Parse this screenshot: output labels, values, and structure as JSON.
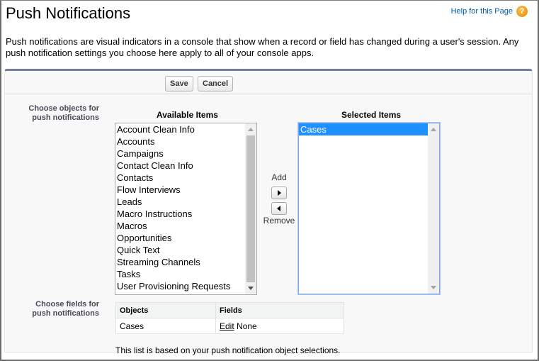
{
  "page": {
    "title": "Push Notifications",
    "help_link": "Help for this Page",
    "help_icon": "question-circle-icon",
    "description": "Push notifications are visual indicators in a console that show when a record or field has changed during a user's session. Any push notification settings you choose here apply to all of your console apps."
  },
  "toolbar": {
    "save_label": "Save",
    "cancel_label": "Cancel"
  },
  "objects_section": {
    "label_line1": "Choose objects for",
    "label_line2": "push notifications",
    "available_heading": "Available Items",
    "selected_heading": "Selected Items",
    "available_items": [
      "Account Clean Info",
      "Accounts",
      "Campaigns",
      "Contact Clean Info",
      "Contacts",
      "Flow Interviews",
      "Leads",
      "Macro Instructions",
      "Macros",
      "Opportunities",
      "Quick Text",
      "Streaming Channels",
      "Tasks",
      "User Provisioning Requests"
    ],
    "selected_items": [
      "Cases"
    ],
    "selected_highlighted": "Cases",
    "add_label": "Add",
    "remove_label": "Remove",
    "add_icon": "arrow-right-icon",
    "remove_icon": "arrow-left-icon"
  },
  "fields_section": {
    "label_line1": "Choose fields for",
    "label_line2": "push notifications",
    "columns": [
      "Objects",
      "Fields"
    ],
    "rows": [
      {
        "object": "Cases",
        "edit_label": "Edit",
        "fields": "None"
      }
    ],
    "note": "This list is based on your push notification object selections."
  },
  "colors": {
    "panel_top_border": "#747e96",
    "selection": "#1e90ff",
    "help_link": "#015ba7",
    "help_icon": "#e58a0a"
  }
}
